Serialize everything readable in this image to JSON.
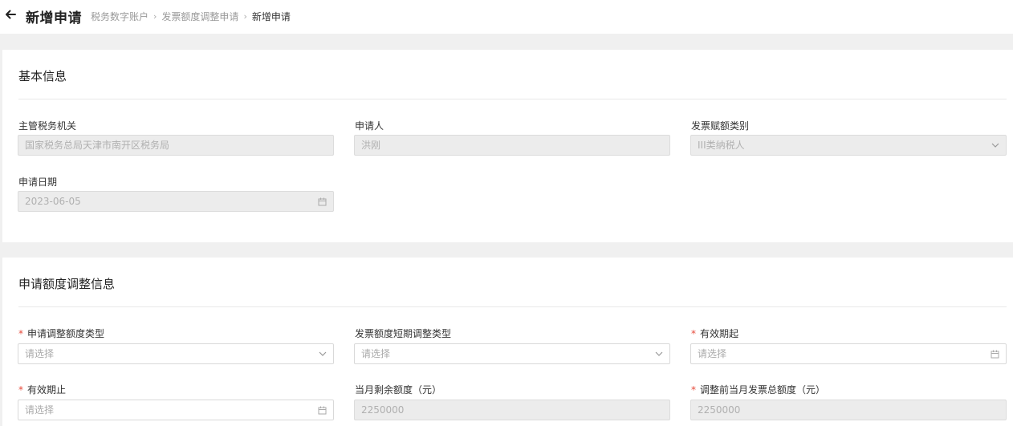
{
  "header": {
    "title": "新增申请",
    "breadcrumb": [
      "税务数字账户",
      "发票额度调整申请",
      "新增申请"
    ]
  },
  "basic": {
    "section_title": "基本信息",
    "tax_authority": {
      "label": "主管税务机关",
      "value": "国家税务总局天津市南开区税务局"
    },
    "applicant": {
      "label": "申请人",
      "value": "洪刚"
    },
    "invoice_category": {
      "label": "发票赋额类别",
      "value": "III类纳税人"
    },
    "apply_date": {
      "label": "申请日期",
      "value": "2023-06-05"
    }
  },
  "adjust": {
    "section_title": "申请额度调整信息",
    "adjust_type": {
      "label": "申请调整额度类型",
      "placeholder": "请选择",
      "required": true
    },
    "short_term_type": {
      "label": "发票额度短期调整类型",
      "placeholder": "请选择"
    },
    "valid_from": {
      "label": "有效期起",
      "placeholder": "请选择",
      "required": true
    },
    "valid_to": {
      "label": "有效期止",
      "placeholder": "请选择",
      "required": true
    },
    "remaining_amount": {
      "label": "当月剩余额度（元）",
      "value": "2250000"
    },
    "total_before": {
      "label": "调整前当月发票总额度（元）",
      "value": "2250000",
      "required": true
    }
  },
  "required_mark": "*",
  "colors": {
    "required": "#e64a3b",
    "disabled_bg": "#ececec",
    "page_bg": "#f0f0f0"
  },
  "icons": {
    "back": "arrow-left-icon",
    "select": "chevron-down-icon",
    "date": "calendar-icon"
  }
}
